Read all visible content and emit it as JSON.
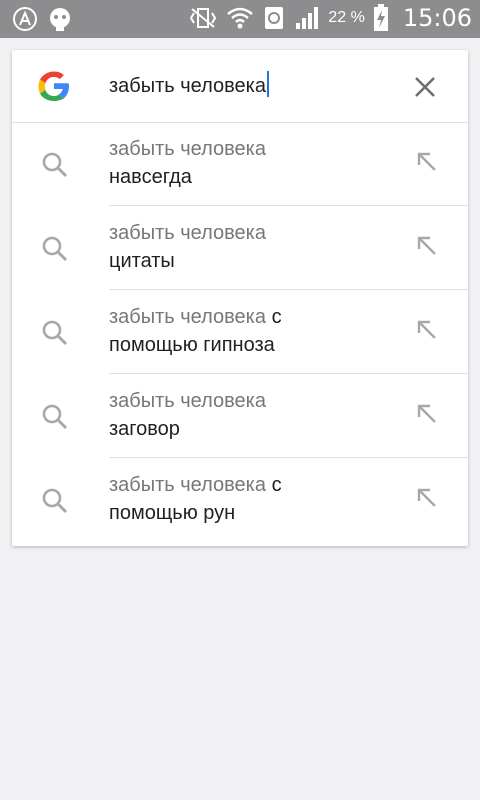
{
  "status_bar": {
    "battery_percent": "22 %",
    "time": "15:06"
  },
  "search": {
    "query": "забыть человека"
  },
  "suggestions": [
    {
      "query": "забыть человека",
      "completion": "навсегда",
      "completion_inline": false
    },
    {
      "query": "забыть человека",
      "completion": "цитаты",
      "completion_inline": false
    },
    {
      "query": "забыть человека",
      "completion_line1": "с",
      "completion_line2": "помощью гипноза"
    },
    {
      "query": "забыть человека",
      "completion": "заговор",
      "completion_inline": false
    },
    {
      "query": "забыть человека",
      "completion_line1": "с",
      "completion_line2": "помощью рун"
    }
  ],
  "colors": {
    "status_bar": "#8d8d8f",
    "background": "#f1f0f3",
    "cursor": "#2b6fe8",
    "suggestion_gray": "#777777"
  },
  "icons": [
    "google-g-icon",
    "clear-icon",
    "search-icon",
    "fill-query-arrow-icon"
  ]
}
